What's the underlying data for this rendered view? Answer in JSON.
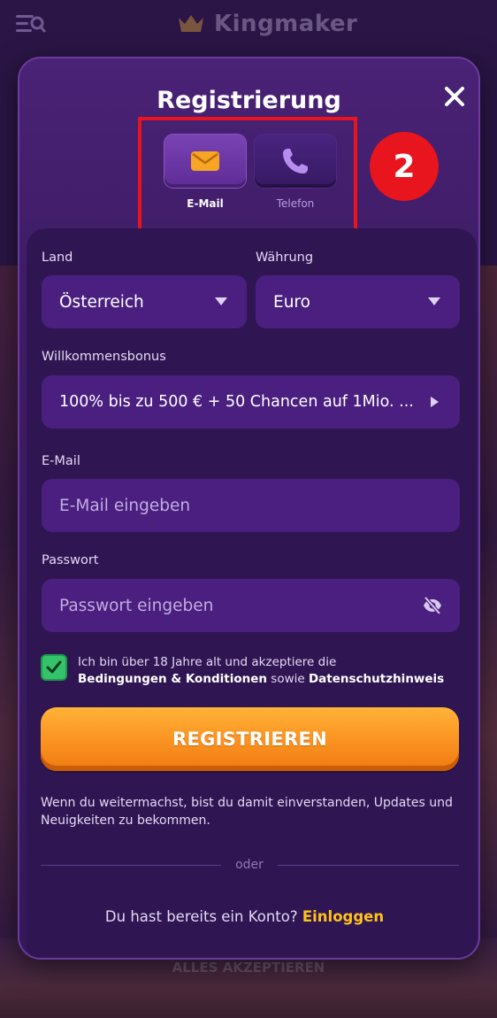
{
  "app": {
    "brand": "Kingmaker"
  },
  "background": {
    "cookie_button": "ALLES AKZEPTIEREN"
  },
  "modal": {
    "title": "Registrierung",
    "step_badge": "2",
    "methods": [
      {
        "label": "E-Mail",
        "icon": "envelope-icon",
        "active": true
      },
      {
        "label": "Telefon",
        "icon": "phone-icon",
        "active": false
      }
    ]
  },
  "form": {
    "country": {
      "label": "Land",
      "value": "Österreich"
    },
    "currency": {
      "label": "Währung",
      "value": "Euro"
    },
    "bonus": {
      "label": "Willkommensbonus",
      "value": "100% bis zu 500 € + 50 Chancen auf 1Mio. ..."
    },
    "email": {
      "label": "E-Mail",
      "placeholder": "E-Mail eingeben"
    },
    "password": {
      "label": "Passwort",
      "placeholder": "Passwort eingeben"
    },
    "terms": {
      "checked": true,
      "prefix": "Ich bin über 18 Jahre alt und akzeptiere die",
      "link_terms": "Bedingungen & Konditionen",
      "middle": "sowie",
      "link_privacy": "Datenschutzhinweis"
    },
    "register_button": "REGISTRIEREN",
    "consent": "Wenn du weitermachst, bist du damit einverstanden, Updates und Neuigkeiten zu bekommen.",
    "divider": "oder",
    "login_prompt": "Du hast bereits ein Konto?",
    "login_link": "Einloggen"
  },
  "colors": {
    "accent": "#fb9422",
    "link": "#ffc21a",
    "modal_bg": "#3e1c66",
    "field_bg": "#4a1f80",
    "checkbox": "#34c36a",
    "annotation": "#e8141e"
  }
}
